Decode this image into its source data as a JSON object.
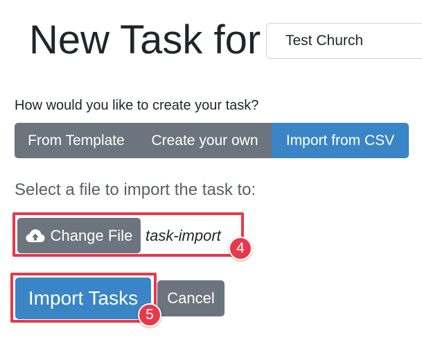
{
  "header": {
    "title": "New Task for",
    "organization_select_value": "Test Church"
  },
  "create_method": {
    "question": "How would you like to create your task?",
    "options": [
      "From Template",
      "Create your own",
      "Import from CSV"
    ],
    "selected": "Import from CSV"
  },
  "file_import": {
    "label": "Select a file to import the task to:",
    "change_file_label": "Change File",
    "upload_icon": "cloud-upload-icon",
    "file_name": "task-import"
  },
  "actions": {
    "import_label": "Import Tasks",
    "cancel_label": "Cancel"
  },
  "annotations": {
    "step_file": "4",
    "step_import": "5",
    "highlight_color": "#e8384b"
  },
  "colors": {
    "primary": "#3a85c6",
    "secondary": "#6c757d"
  }
}
